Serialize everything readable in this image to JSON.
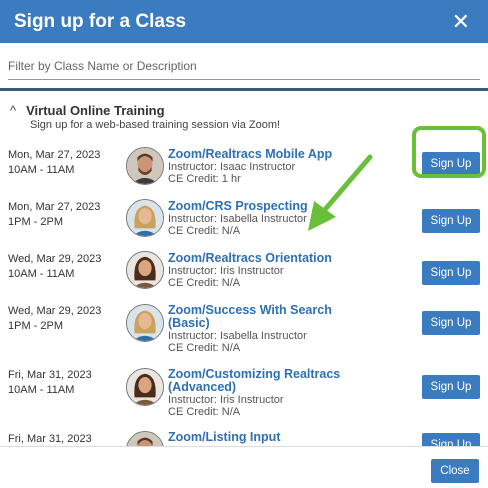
{
  "modal": {
    "title": "Sign up for a Class",
    "close_symbol": "✕"
  },
  "filter": {
    "placeholder": "Filter by Class Name or Description",
    "value": ""
  },
  "section": {
    "chevron": "^",
    "title": "Virtual Online Training",
    "subtitle": "Sign up for a web-based training session via Zoom!"
  },
  "classes": [
    {
      "date": "Mon, Mar 27, 2023",
      "time": "10AM - 11AM",
      "title_lines": [
        "Zoom/Realtracs Mobile App"
      ],
      "instructor": "Instructor: Isaac Instructor",
      "ce": "CE Credit: 1 hr",
      "button": "Sign Up",
      "avatar": "male-instructor-avatar"
    },
    {
      "date": "Mon, Mar 27, 2023",
      "time": "1PM - 2PM",
      "title_lines": [
        "Zoom/CRS Prospecting"
      ],
      "instructor": "Instructor:   Isabella Instructor",
      "ce": "CE Credit: N/A",
      "button": "Sign Up",
      "avatar": "female-instructor-avatar"
    },
    {
      "date": "Wed, Mar 29, 2023",
      "time": "10AM - 11AM",
      "title_lines": [
        "Zoom/Realtracs Orientation"
      ],
      "instructor": "Instructor:   Iris Instructor",
      "ce": "CE Credit: N/A",
      "button": "Sign Up",
      "avatar": "female-instructor-avatar"
    },
    {
      "date": "Wed, Mar 29, 2023",
      "time": "1PM - 2PM",
      "title_lines": [
        "Zoom/Success With Search",
        "(Basic)"
      ],
      "instructor": "Instructor:   Isabella Instructor",
      "ce": "CE Credit: N/A",
      "button": "Sign Up",
      "avatar": "female-instructor-avatar"
    },
    {
      "date": "Fri, Mar 31, 2023",
      "time": "10AM - 11AM",
      "title_lines": [
        "Zoom/Customizing Realtracs",
        "(Advanced)"
      ],
      "instructor": "Instructor: Iris Instructor",
      "ce": "CE Credit: N/A",
      "button": "Sign Up",
      "avatar": "female-instructor-avatar"
    },
    {
      "date": "Fri, Mar 31, 2023",
      "time": "",
      "title_lines": [
        "Zoom/Listing Input"
      ],
      "instructor": "",
      "ce": "",
      "button": "Sign Up",
      "avatar": "male-instructor-avatar"
    }
  ],
  "footer": {
    "close_label": "Close"
  },
  "colors": {
    "brand_blue": "#3b7bc0",
    "highlight_green": "#6abf3a",
    "link_blue": "#2f6fb3"
  }
}
